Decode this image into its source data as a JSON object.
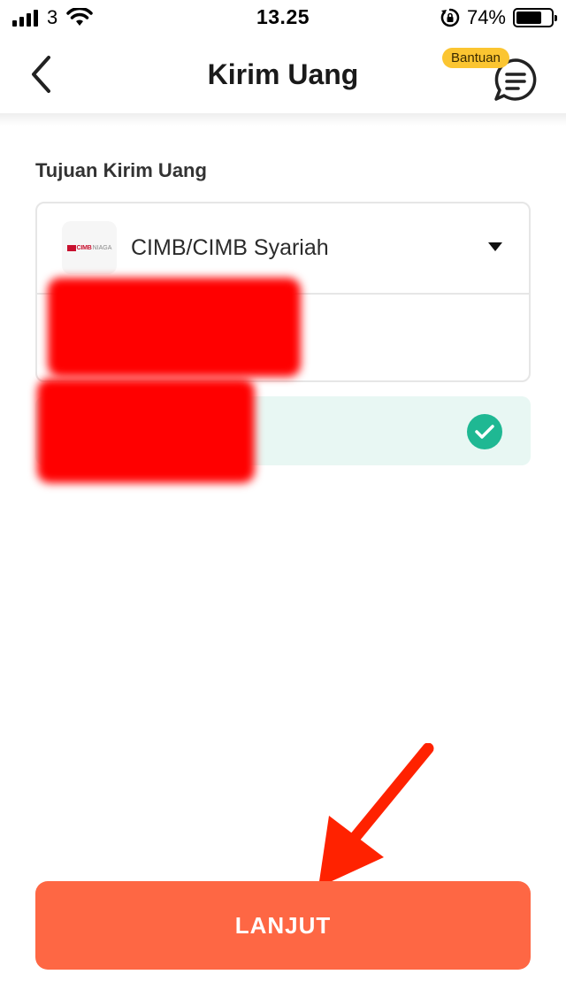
{
  "status_bar": {
    "carrier": "3",
    "time": "13.25",
    "battery_percent": "74%",
    "battery_level": 0.74,
    "icons": [
      "signal-icon",
      "wifi-icon",
      "rotation-lock-icon",
      "battery-icon"
    ]
  },
  "header": {
    "title": "Kirim Uang",
    "help_badge": "Bantuan",
    "icons": [
      "back-chevron-icon",
      "chat-help-icon"
    ]
  },
  "form": {
    "section_label": "Tujuan Kirim Uang",
    "bank": {
      "logo_text": "CIMB",
      "logo_subtext": "NIAGA",
      "name": "CIMB/CIMB Syariah"
    },
    "account_number_value": "",
    "verified_name": "",
    "verified": true
  },
  "actions": {
    "continue_label": "LANJUT"
  },
  "colors": {
    "primary": "#fe6744",
    "success": "#1fb893",
    "success_bg": "#e8f7f3",
    "badge": "#fbc531",
    "annotation_arrow": "#ff2200"
  }
}
